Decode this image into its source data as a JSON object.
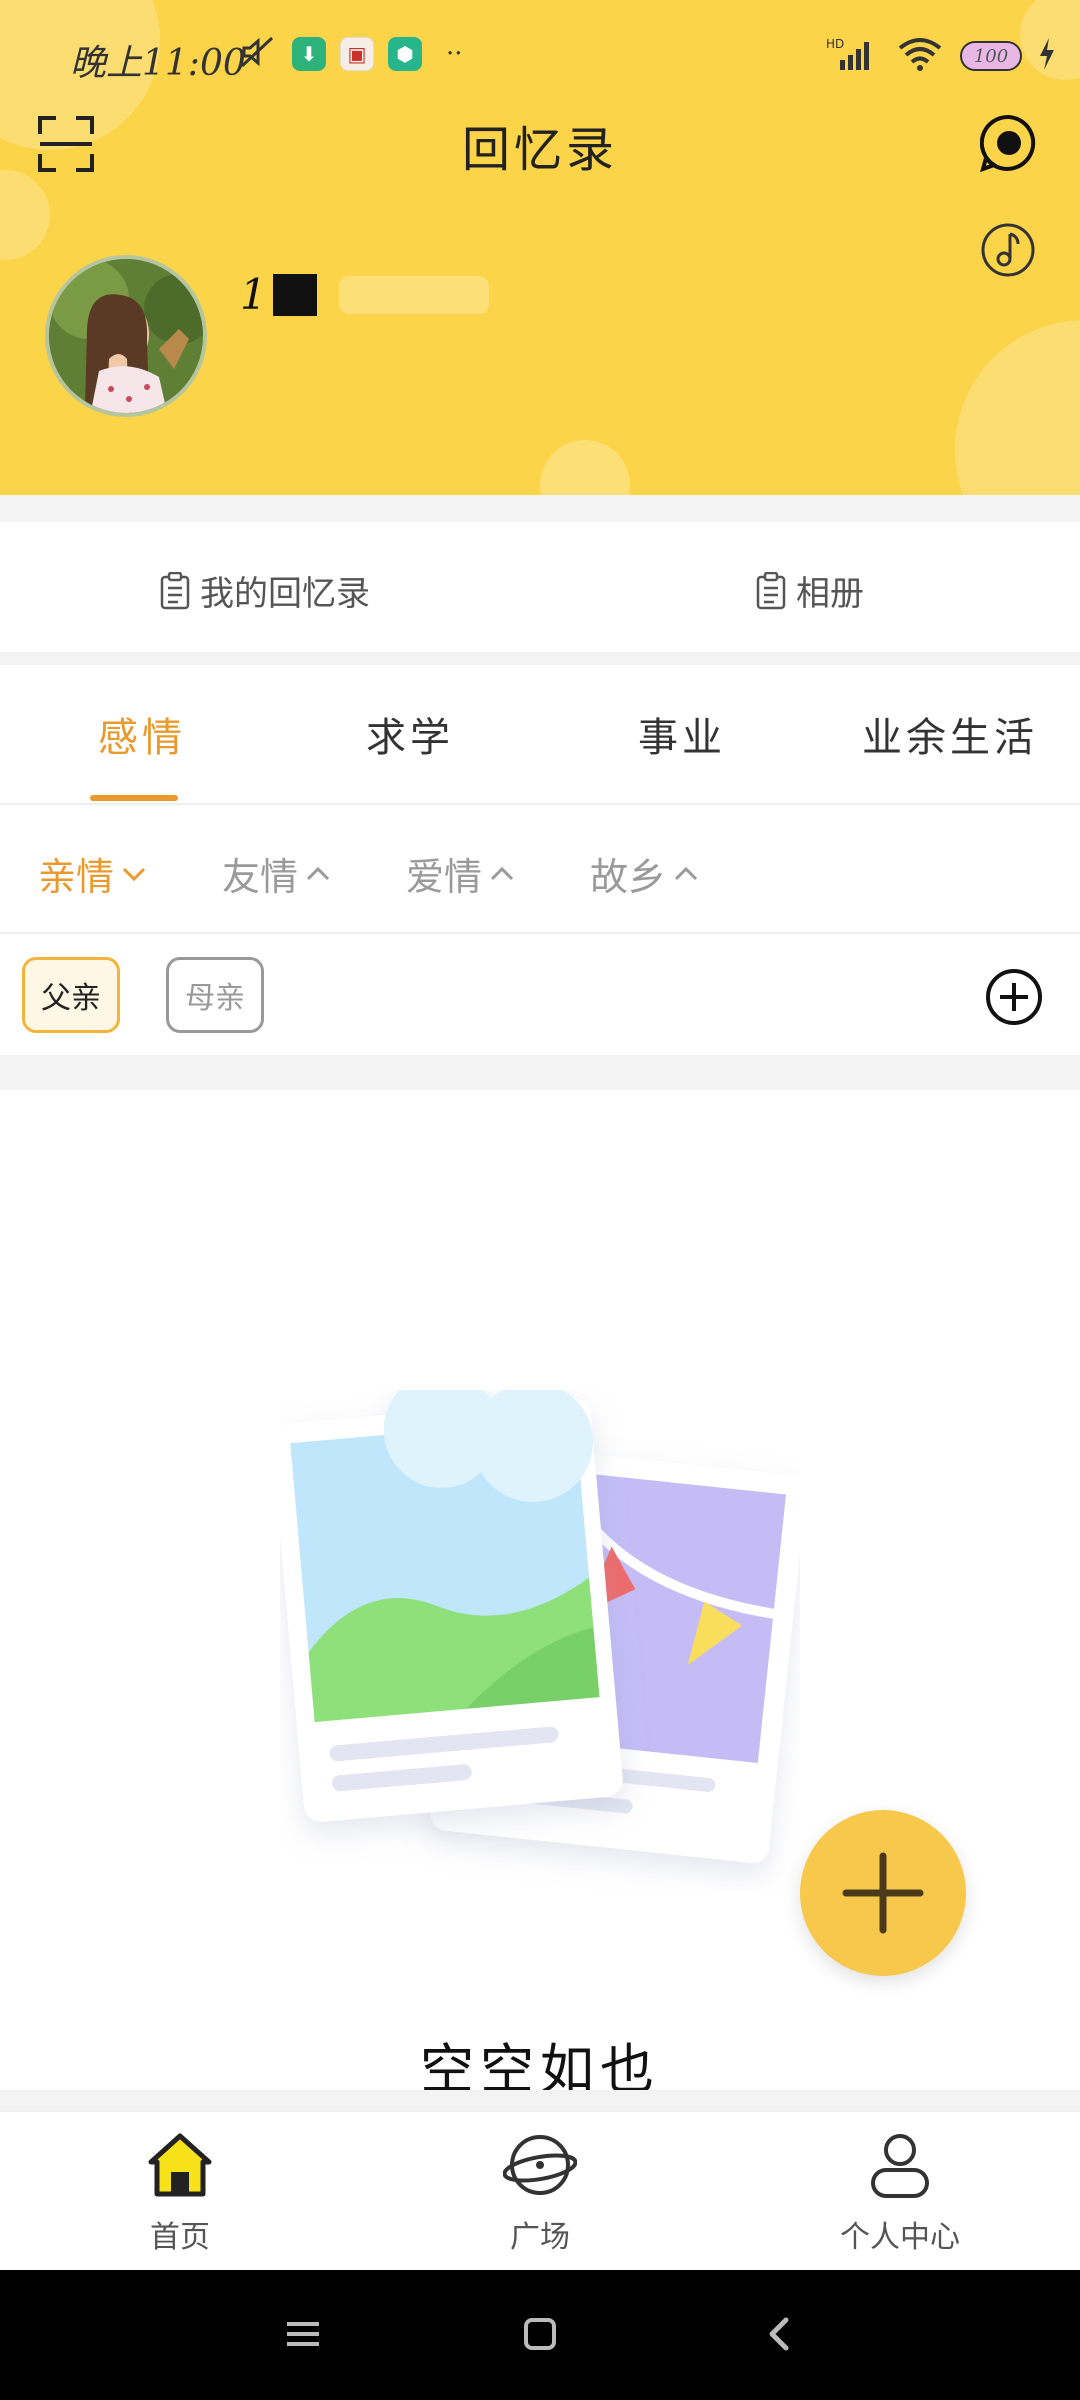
{
  "status_bar": {
    "time": "晚上11:00",
    "more": "··",
    "battery": "100"
  },
  "header": {
    "title": "回忆录",
    "username_prefix": "1"
  },
  "links": {
    "my_memoirs": "我的回忆录",
    "album": "相册"
  },
  "tabs": [
    {
      "label": "感情"
    },
    {
      "label": "求学"
    },
    {
      "label": "事业"
    },
    {
      "label": "业余生活"
    }
  ],
  "subtabs": [
    {
      "label": "亲情"
    },
    {
      "label": "友情"
    },
    {
      "label": "爱情"
    },
    {
      "label": "故乡"
    }
  ],
  "chips": [
    {
      "label": "父亲"
    },
    {
      "label": "母亲"
    }
  ],
  "empty": {
    "text": "空空如也"
  },
  "bottom_nav": [
    {
      "label": "首页",
      "icon": "home-icon"
    },
    {
      "label": "广场",
      "icon": "planet-icon"
    },
    {
      "label": "个人中心",
      "icon": "person-icon"
    }
  ],
  "colors": {
    "header_bg": "#FCD44A",
    "accent": "#E89A2E",
    "fab": "#F8C84C"
  }
}
